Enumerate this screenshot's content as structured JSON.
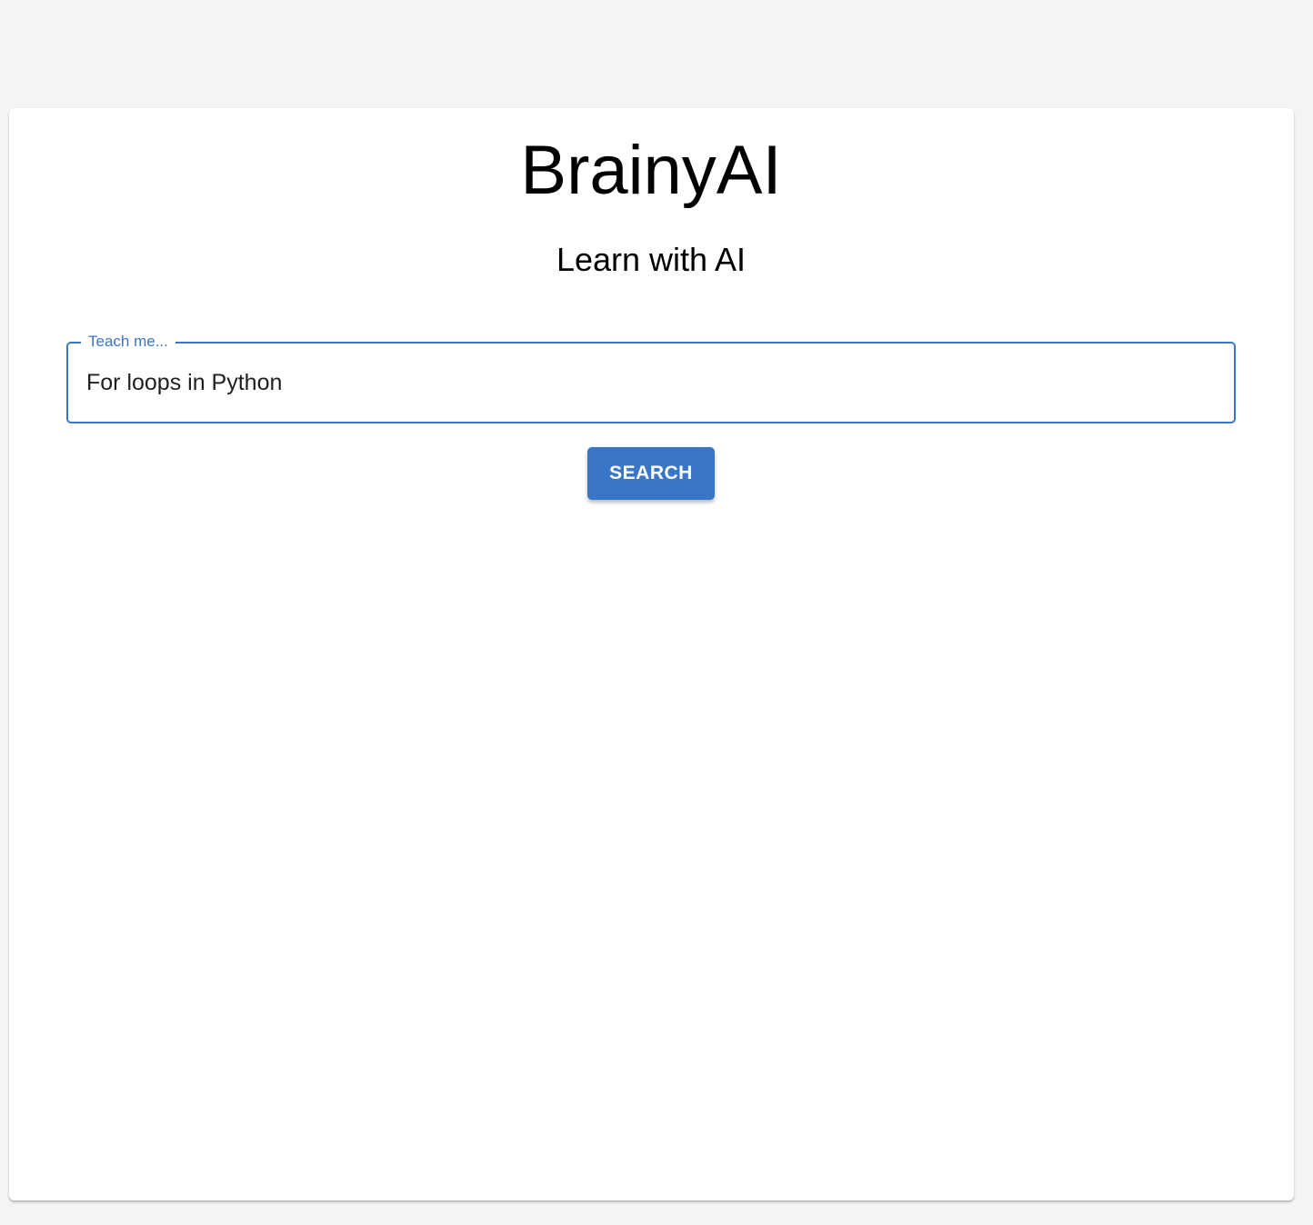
{
  "app": {
    "title": "BrainyAI",
    "subtitle": "Learn with AI"
  },
  "search": {
    "label": "Teach me...",
    "value": "For loops in Python",
    "button_label": "SEARCH"
  },
  "colors": {
    "accent": "#3a76c6",
    "background": "#f4f4f4",
    "card": "#ffffff",
    "text": "#000000"
  }
}
